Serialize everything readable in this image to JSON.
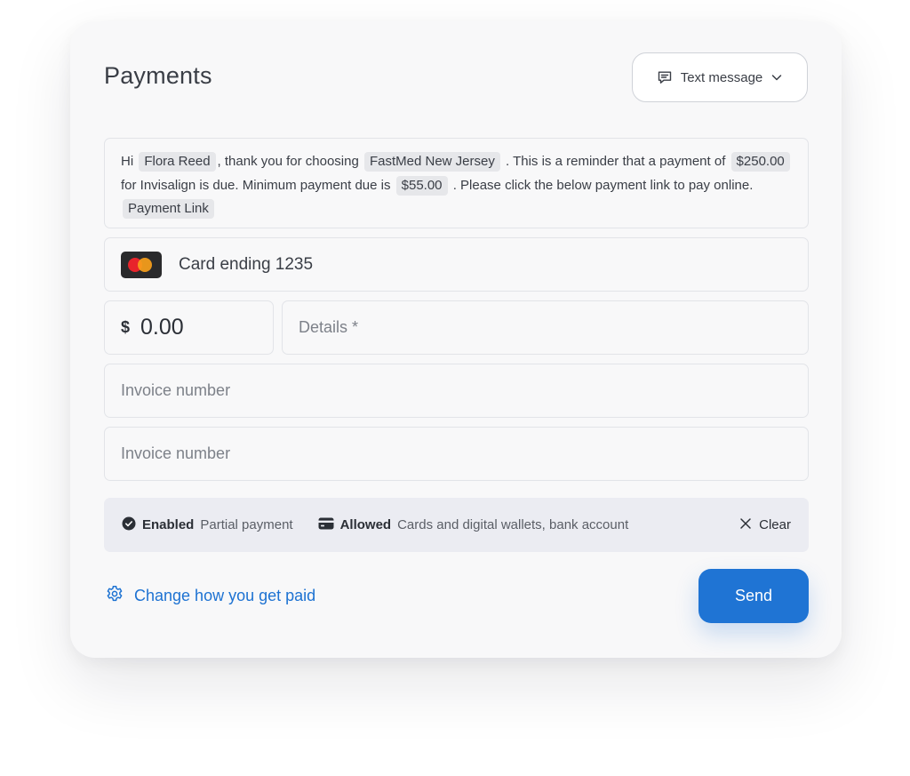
{
  "header": {
    "title": "Payments",
    "channel": {
      "label": "Text message",
      "icon": "message-icon",
      "chevron": "chevron-down-icon"
    }
  },
  "message": {
    "p1": "Hi",
    "name": "Flora Reed",
    "p2": ", thank you for choosing",
    "clinic": "FastMed New Jersey",
    "p3": ". This is a reminder that a payment of",
    "amount": "$250.00",
    "p4": "for Invisalign is due. Minimum payment due is",
    "minimum": "$55.00",
    "p5": ". Please click the below payment link to pay online.",
    "link": "Payment Link"
  },
  "payment_method": {
    "label": "Card ending 1235",
    "brand": "mastercard",
    "colors": {
      "background": "#2a2a2c",
      "left": "#e8242b",
      "right": "#f8a01b"
    }
  },
  "amount": {
    "currency": "$",
    "value": "0.00"
  },
  "fields": {
    "details_placeholder": "Details *",
    "invoice1_placeholder": "Invoice number",
    "invoice2_placeholder": "Invoice number"
  },
  "options": {
    "partial": {
      "status": "Enabled",
      "label": "Partial payment",
      "icon": "check-circle-icon"
    },
    "methods": {
      "status": "Allowed",
      "label": "Cards and digital wallets, bank account",
      "icon": "card-icon"
    },
    "clear_label": "Clear"
  },
  "footer": {
    "change_label": "Change how you get paid",
    "send_label": "Send"
  },
  "colors": {
    "accent": "#1f74d4",
    "link": "#1d72d2",
    "option_bar": "#ebecf2",
    "surface": "#f8f8f9"
  }
}
